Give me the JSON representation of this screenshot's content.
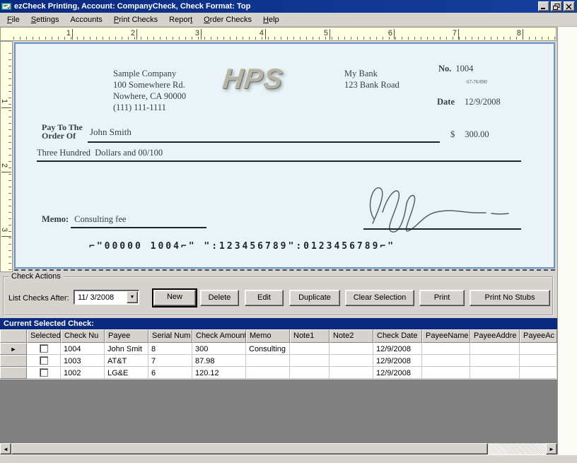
{
  "window": {
    "title": "ezCheck Printing, Account: CompanyCheck, Check Format: Top"
  },
  "menu": {
    "items": [
      {
        "label": "File",
        "underline": 0
      },
      {
        "label": "Settings",
        "underline": 0
      },
      {
        "label": "Accounts",
        "underline": -1
      },
      {
        "label": "Print Checks",
        "underline": 0
      },
      {
        "label": "Report",
        "underline": 5
      },
      {
        "label": "Order Checks",
        "underline": 0
      },
      {
        "label": "Help",
        "underline": 0
      }
    ]
  },
  "ruler": {
    "horizontal": [
      "1",
      "2",
      "3",
      "4",
      "5",
      "6",
      "7",
      "8"
    ],
    "vertical": [
      "1",
      "2",
      "3"
    ]
  },
  "check": {
    "company": {
      "name": "Sample Company",
      "address1": "100 Somewhere Rd.",
      "address2": "Nowhere, CA 90000",
      "phone": "(111) 111-1111"
    },
    "logo": "HPS",
    "bank": {
      "name": "My Bank",
      "address": "123 Bank Road"
    },
    "no_label": "No.",
    "check_number": "1004",
    "fraction": "67-76/890",
    "date_label": "Date",
    "date_value": "12/9/2008",
    "pay_to_line1": "Pay To The",
    "pay_to_line2": "Order Of",
    "payee": "John Smith",
    "currency": "$",
    "amount": "300.00",
    "amount_words": "Three Hundred  Dollars and 00/100",
    "memo_label": "Memo:",
    "memo_value": "Consulting fee",
    "micr": "⌐\"00000 1004⌐\" \":123456789\":0123456789⌐\""
  },
  "check_actions": {
    "group_label": "Check Actions",
    "list_after_label": "List Checks After:",
    "date_value": "11/ 3/2008",
    "buttons": [
      "New",
      "Delete",
      "Edit",
      "Duplicate",
      "Clear Selection",
      "Print",
      "Print No Stubs"
    ]
  },
  "grid": {
    "title": "Current Selected Check:",
    "columns": [
      "Selected",
      "Check Nu",
      "Payee",
      "Serial Num",
      "Check Amount",
      "Memo",
      "Note1",
      "Note2",
      "Check Date",
      "PayeeName",
      "PayeeAddre",
      "PayeeAc"
    ],
    "rows": [
      [
        "",
        "1004",
        "John Smit",
        "8",
        "300",
        "Consulting",
        "",
        "",
        "12/9/2008",
        "",
        "",
        ""
      ],
      [
        "",
        "1003",
        "AT&T",
        "7",
        "87.98",
        "",
        "",
        "",
        "12/9/2008",
        "",
        "",
        ""
      ],
      [
        "",
        "1002",
        "LG&E",
        "6",
        "120.12",
        "",
        "",
        "",
        "12/9/2008",
        "",
        "",
        ""
      ]
    ]
  },
  "colors": {
    "title_bar": "#0a2a80",
    "caption_bar": "#0a2a80",
    "button_face": "#d6d3ce",
    "check_background": "#e9f3f8",
    "check_border": "#6a93cc",
    "ruler_background": "#ffffe1",
    "grid_empty": "#808080"
  }
}
